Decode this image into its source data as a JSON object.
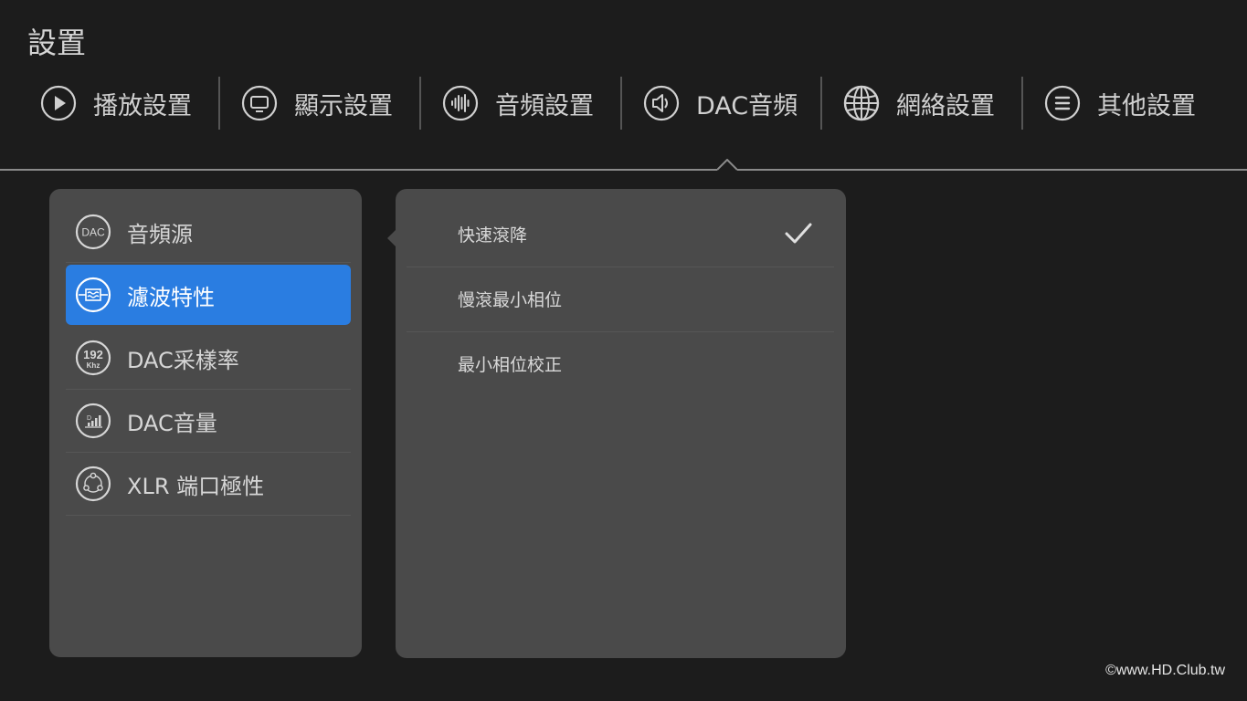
{
  "page": {
    "title": "設置"
  },
  "tabs": [
    {
      "label": "播放設置",
      "icon": "play-icon"
    },
    {
      "label": "顯示設置",
      "icon": "monitor-icon"
    },
    {
      "label": "音頻設置",
      "icon": "audio-wave-icon"
    },
    {
      "label": "DAC音頻",
      "icon": "speaker-icon"
    },
    {
      "label": "網絡設置",
      "icon": "globe-icon"
    },
    {
      "label": "其他設置",
      "icon": "menu-list-icon"
    }
  ],
  "active_tab": "DAC音頻",
  "menu": {
    "items": [
      {
        "label": "音頻源",
        "icon": "dac-icon",
        "icon_text": "DAC"
      },
      {
        "label": "濾波特性",
        "icon": "filter-icon"
      },
      {
        "label": "DAC采樣率",
        "icon": "sample-rate-icon",
        "icon_text": "192",
        "icon_subtext": "Khz"
      },
      {
        "label": "DAC音量",
        "icon": "volume-bars-icon"
      },
      {
        "label": "XLR 端口極性",
        "icon": "polarity-icon"
      }
    ],
    "selected": "濾波特性"
  },
  "options": {
    "items": [
      {
        "label": "快速滾降"
      },
      {
        "label": "慢滾最小相位"
      },
      {
        "label": "最小相位校正"
      }
    ],
    "checked": "快速滾降"
  },
  "watermark": "©www.HD.Club.tw",
  "colors": {
    "accent": "#2a7de1",
    "background": "#1c1c1c",
    "panel": "#4a4a4a"
  }
}
